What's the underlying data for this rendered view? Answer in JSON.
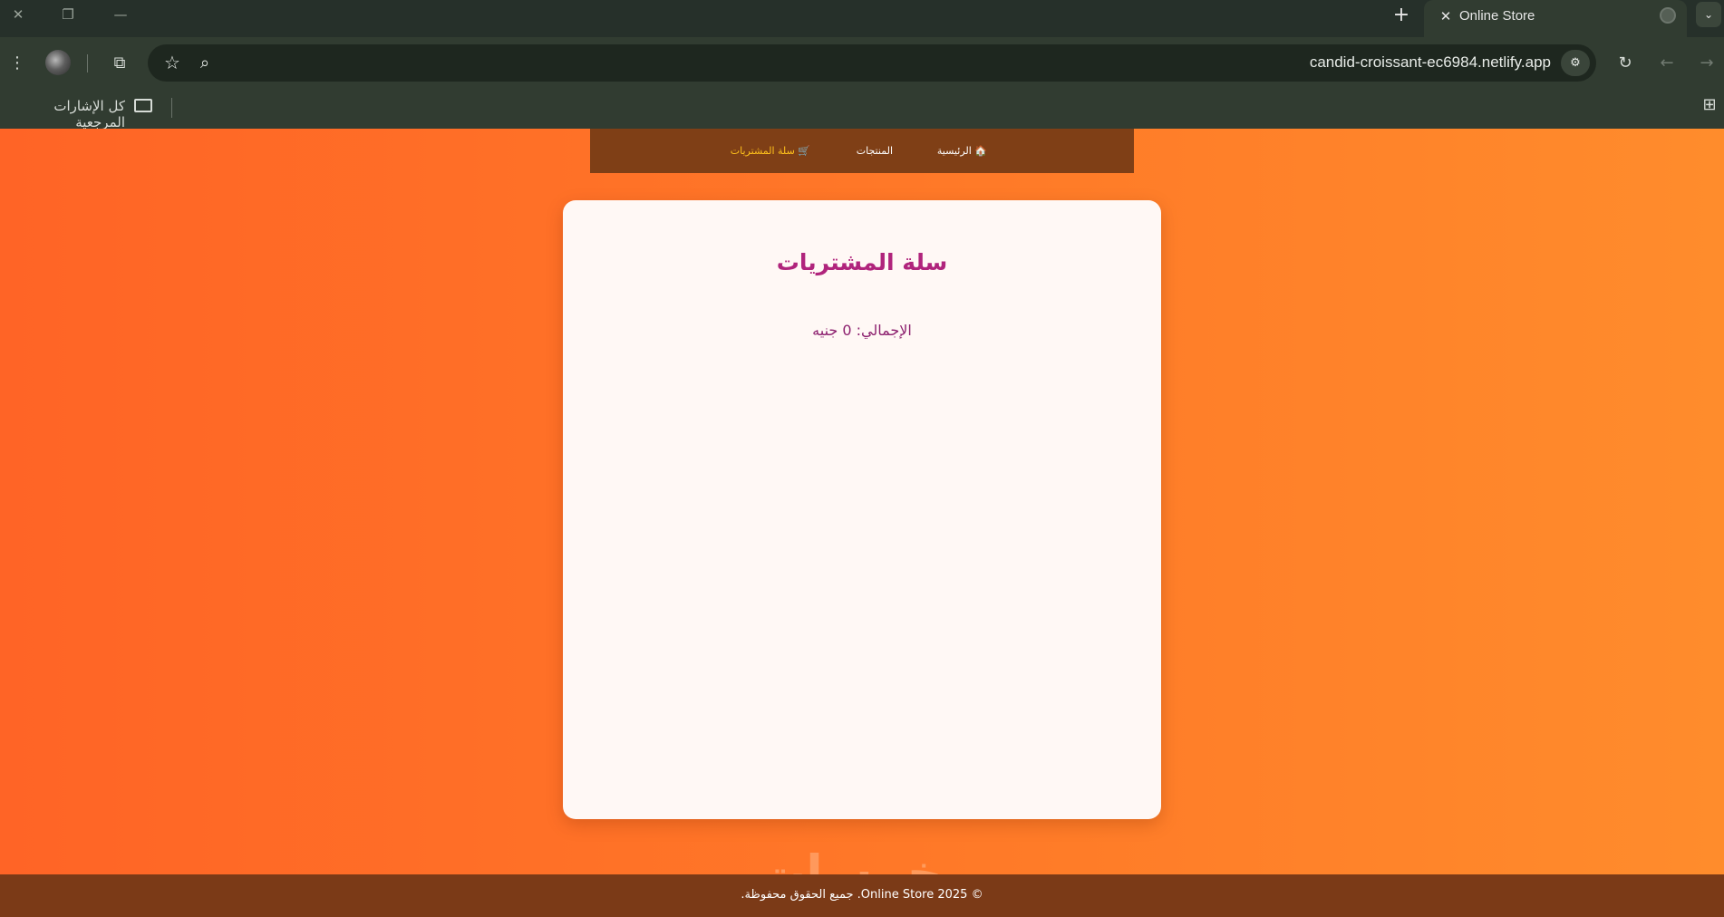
{
  "browser": {
    "tab_title": "Online Store",
    "url": "candid-croissant-ec6984.netlify.app",
    "bookmark_all_label": "كل الإشارات المرجعية"
  },
  "nav": {
    "items": [
      {
        "label": "الرئيسية",
        "icon": "home-icon"
      },
      {
        "label": "المنتجات"
      },
      {
        "label": "سلة المشتريات",
        "icon": "cart-icon",
        "active": true
      }
    ],
    "active_color": "#ffc21c"
  },
  "cart": {
    "title": "سلة المشتريات",
    "total": "الإجمالي: 0 جنيه"
  },
  "watermark": "خمسات",
  "footer": {
    "text": "© 2025 Online Store. جميع الحقوق محفوظة."
  },
  "colors": {
    "accent": "#b0247c",
    "nav_bg": "#7f3f16",
    "page_gradient_start": "#ff6426",
    "page_gradient_end": "#ff8c2c"
  }
}
